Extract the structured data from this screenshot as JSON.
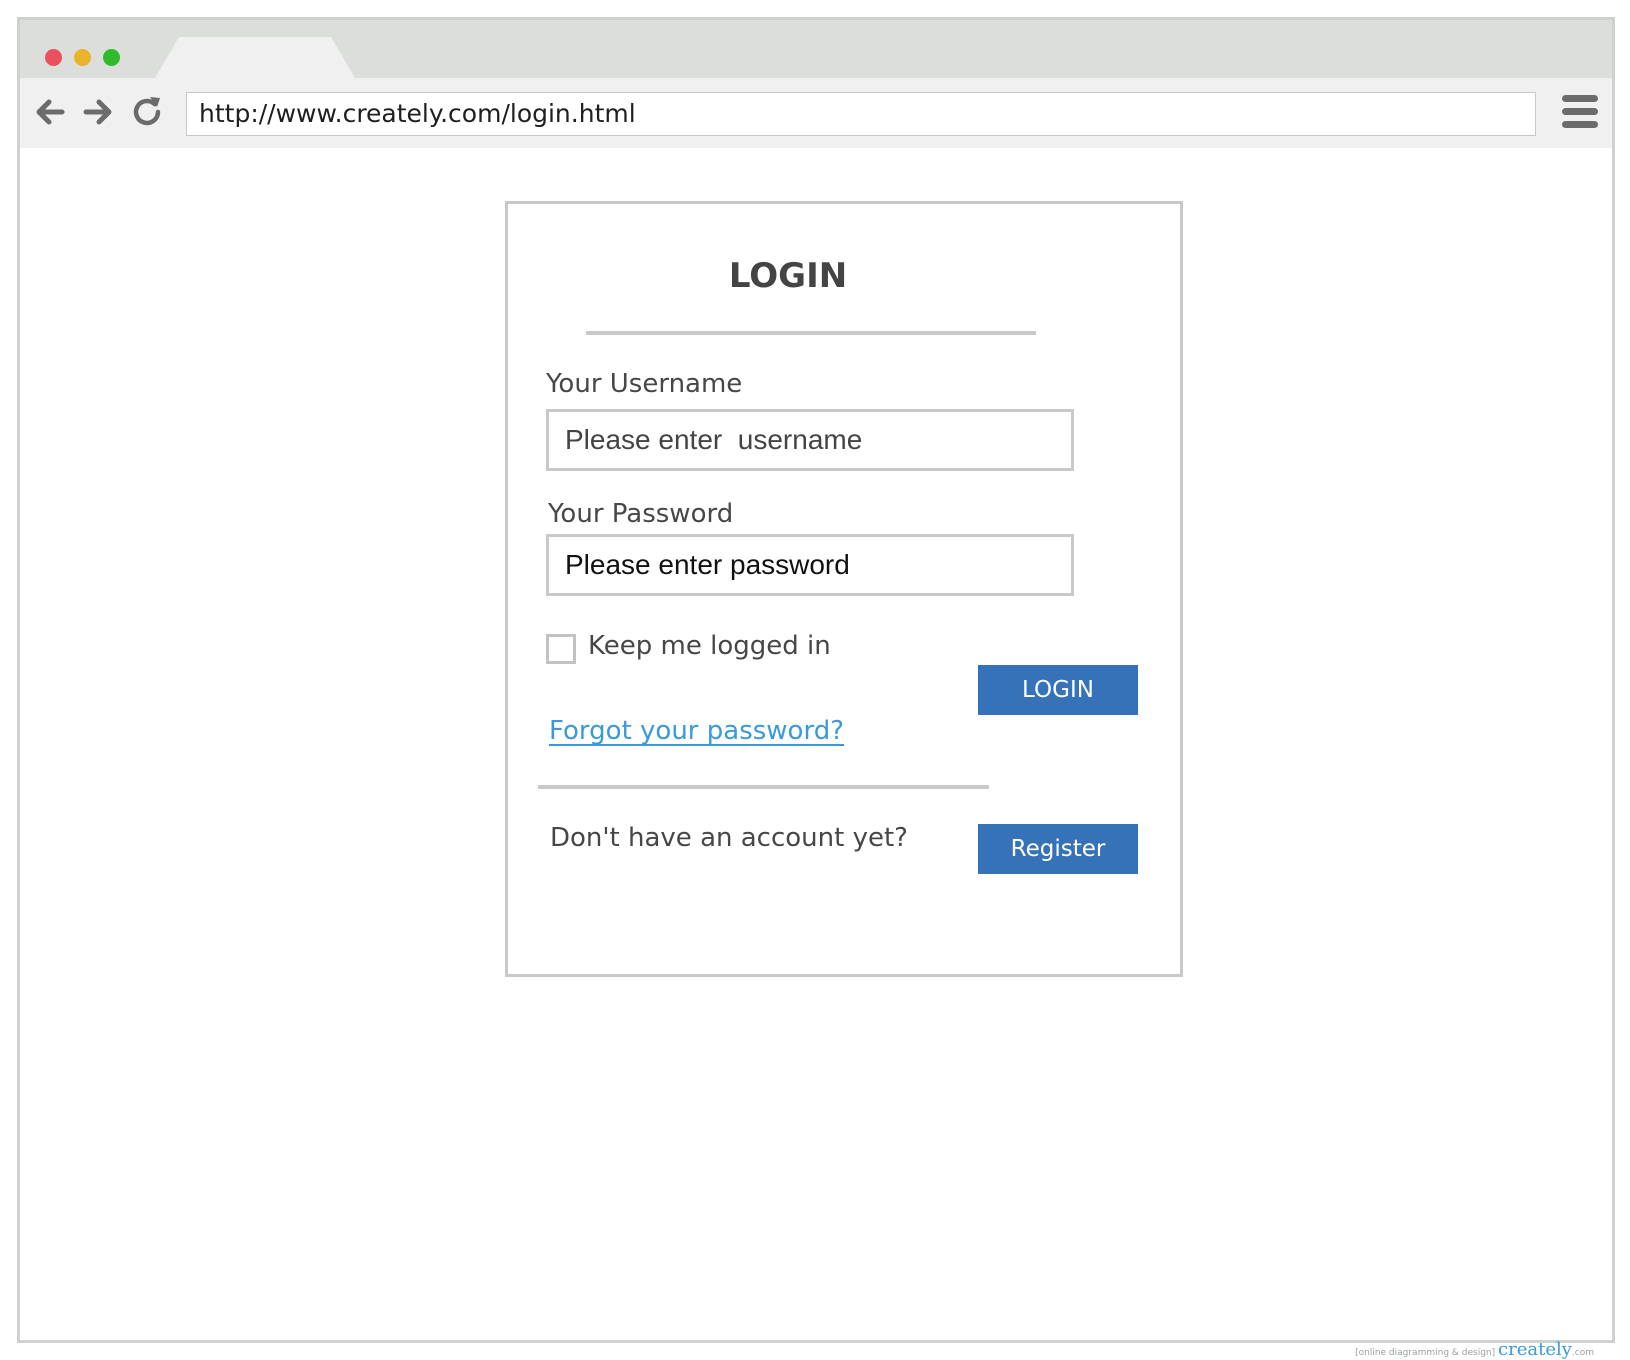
{
  "browser": {
    "url": "http://www.creately.com/login.html",
    "dot_colors": [
      "#e8515d",
      "#e9b429",
      "#2fbb2c"
    ]
  },
  "login": {
    "title": "LOGIN",
    "username_label": "Your Username",
    "username_placeholder": "Please enter  username",
    "password_label": "Your Password",
    "password_placeholder": "Please enter password",
    "keep_logged_in_label": "Keep me logged in",
    "login_button": "LOGIN",
    "forgot_link": "Forgot your password?",
    "no_account_text": "Don't have an account yet?",
    "register_button": "Register"
  },
  "watermark": {
    "tagline": "[online diagramming & design]",
    "logo": "creately",
    "suffix": ".com"
  },
  "colors": {
    "accent_button": "#3572b8",
    "link": "#3a9ad9"
  }
}
